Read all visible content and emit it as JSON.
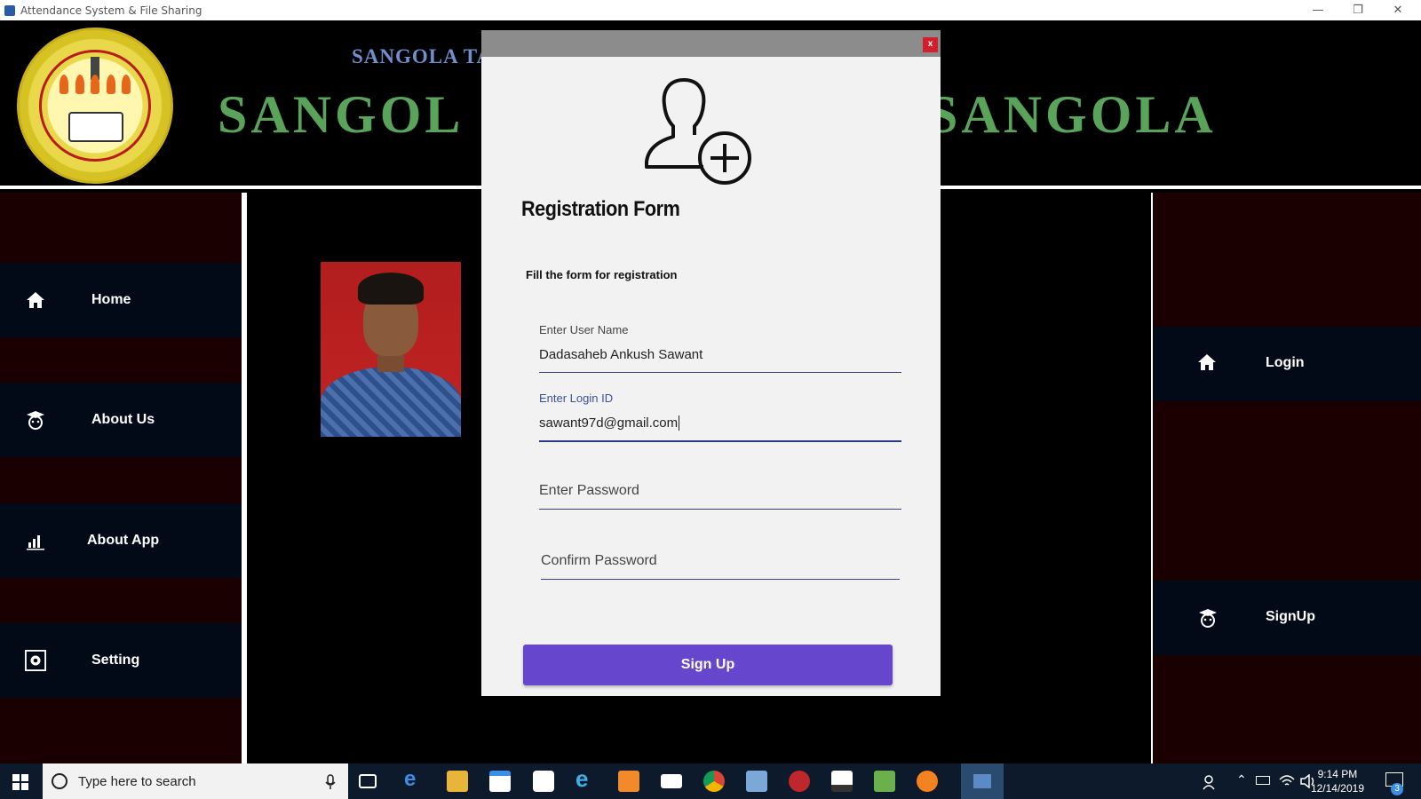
{
  "window": {
    "title": "Attendance System & File Sharing"
  },
  "header": {
    "subtitle": "SANGOLA TA",
    "title_left": "SANGOL",
    "title_right": "SANGOLA"
  },
  "left_nav": [
    {
      "label": "Home",
      "icon": "home-icon"
    },
    {
      "label": "About Us",
      "icon": "student-icon"
    },
    {
      "label": "About App",
      "icon": "chart-icon"
    },
    {
      "label": "Setting",
      "icon": "gear-icon"
    }
  ],
  "right_nav": [
    {
      "label": "Login",
      "icon": "home-icon"
    },
    {
      "label": "SignUp",
      "icon": "student-icon"
    }
  ],
  "modal": {
    "close": "x",
    "title": "Registration Form",
    "subtitle": "Fill the form for registration",
    "fields": {
      "username_label": "Enter User Name",
      "username_value": "Dadasaheb Ankush Sawant",
      "login_label": "Enter Login ID",
      "login_value": "sawant97d@gmail.com",
      "password_placeholder": "Enter Password",
      "confirm_placeholder": "Confirm Password"
    },
    "signup_label": "Sign Up"
  },
  "taskbar": {
    "search_placeholder": "Type here to search",
    "time": "9:14 PM",
    "date": "12/14/2019",
    "notification_count": "3"
  },
  "colors": {
    "accent": "#6646cc",
    "header_green": "#5aa35a",
    "header_blue": "#6f8fcf",
    "sidebar_bg": "#1a0000",
    "nav_item_bg": "#020a18"
  }
}
